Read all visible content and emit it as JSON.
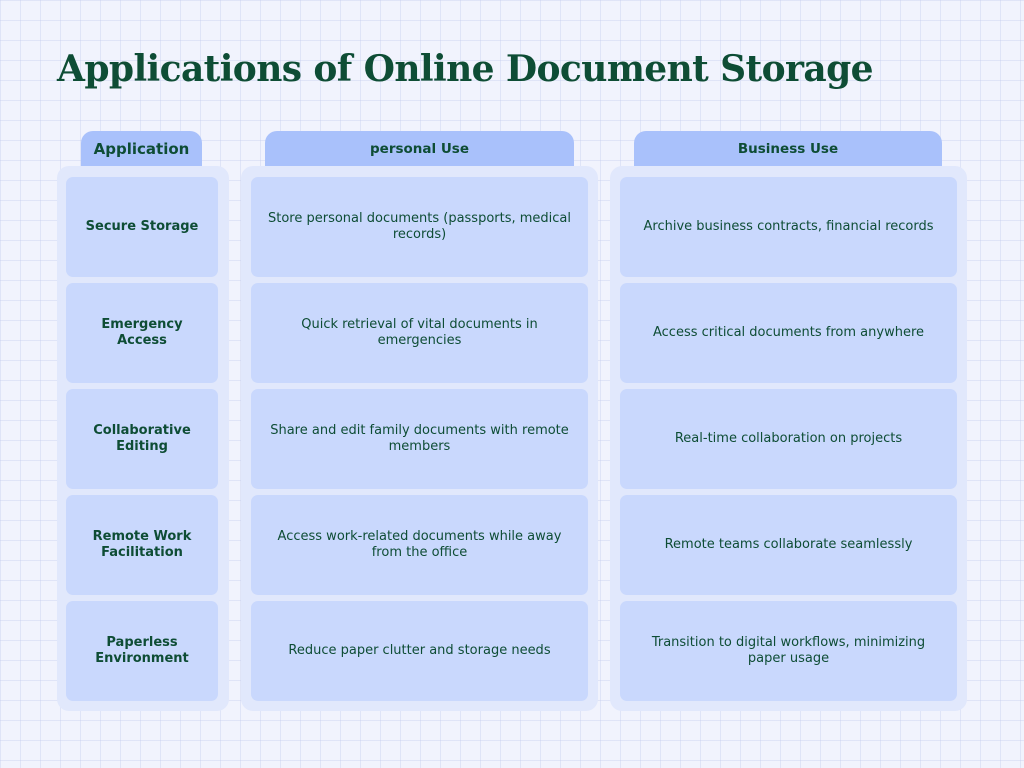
{
  "title": "Applications of Online Document Storage",
  "headers": {
    "application": "Application",
    "personal": "personal Use",
    "business": "Business Use"
  },
  "rows": [
    {
      "application": "Secure Storage",
      "personal": "Store personal documents (passports, medical records)",
      "business": "Archive business contracts, financial records"
    },
    {
      "application": "Emergency Access",
      "personal": "Quick retrieval of vital documents in emergencies",
      "business": "Access critical documents from anywhere"
    },
    {
      "application": "Collaborative Editing",
      "personal": "Share and edit family documents with remote members",
      "business": "Real-time collaboration on projects"
    },
    {
      "application": "Remote Work Facilitation",
      "personal": "Access work-related documents while away from the office",
      "business": "Remote teams collaborate seamlessly"
    },
    {
      "application": "Paperless Environment",
      "personal": "Reduce paper clutter and storage needs",
      "business": "Transition to digital workflows, minimizing paper usage"
    }
  ],
  "colors": {
    "heading": "#0e4d35",
    "tab": "#a9c1fb",
    "panel": "#e1e8fc",
    "cell": "#c9d8fd",
    "background": "#f1f3fd"
  }
}
